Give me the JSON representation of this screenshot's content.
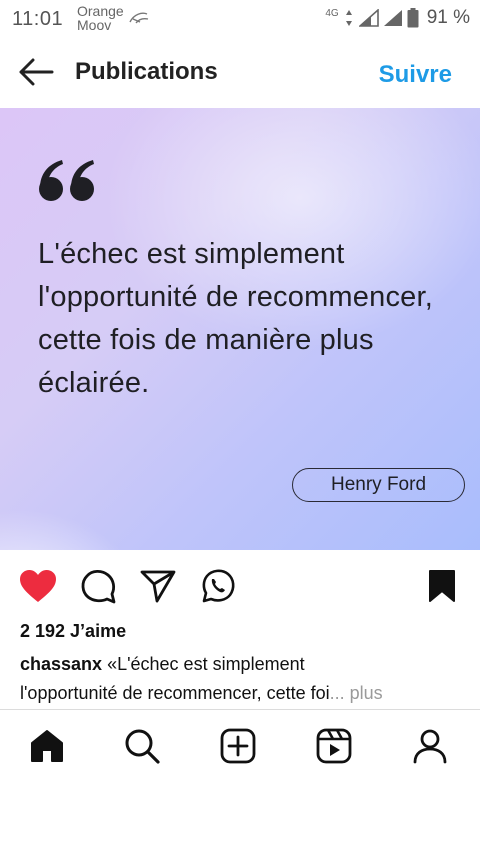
{
  "status_bar": {
    "time": "11:01",
    "carrier_line1": "Orange",
    "carrier_line2": "Moov",
    "network_type": "4G",
    "battery_percent": "91 %"
  },
  "header": {
    "title": "Publications",
    "follow_label": "Suivre",
    "accent_color": "#1e9be6"
  },
  "post": {
    "quote_text": "L'échec est simplement l'opportunité de recommencer, cette fois de manière plus éclairée.",
    "author": "Henry Ford"
  },
  "actions": {
    "liked": true,
    "saved": true,
    "like_color": "#ed2c3f",
    "icons": [
      "heart-icon",
      "comment-icon",
      "share-icon",
      "whatsapp-icon",
      "bookmark-icon"
    ]
  },
  "likes_text": "2 192 J’aime",
  "caption": {
    "username": "chassanx",
    "text_line1": " «L'échec est simplement",
    "text_line2": "l'opportunité de recommencer, cette foi",
    "ellipsis": "...",
    "more_label": " plus"
  },
  "bottom_nav": {
    "icons": [
      "home-icon",
      "search-icon",
      "create-icon",
      "reels-icon",
      "profile-icon"
    ]
  }
}
